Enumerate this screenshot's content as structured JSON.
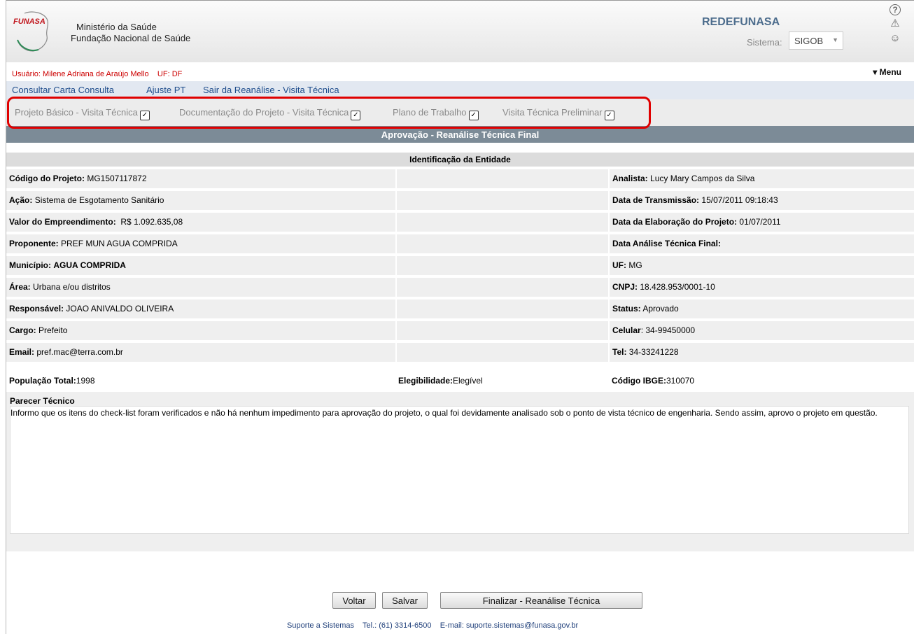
{
  "header": {
    "logo_text": "FUNASA",
    "org_line1": "Ministério da Saúde",
    "org_line2": "Fundação Nacional de Saúde",
    "brand": "REDEFUNASA",
    "system_label": "Sistema:",
    "system_value": "SIGOB",
    "icons": [
      "help-icon",
      "warning-icon",
      "user-icon"
    ]
  },
  "user": {
    "label": "Usuário:",
    "name": "Milene Adriana de Araújo Mello",
    "uf_label": "UF:",
    "uf": "DF",
    "menu_label": "Menu"
  },
  "nav": {
    "items": [
      "Consultar Carta Consulta",
      "Ajuste PT",
      "Sair da Reanálise - Visita Técnica"
    ]
  },
  "tabs": {
    "items": [
      "Projeto Básico - Visita Técnica",
      "Documentação do Projeto - Visita Técnica",
      "Plano de Trabalho",
      "Visita Técnica Preliminar"
    ],
    "check": "✓"
  },
  "section": {
    "title": "Aprovação - Reanálise Técnica Final",
    "subtitle": "Identificação da Entidade"
  },
  "fields": {
    "codigo_label": "Código do Projeto:",
    "codigo": "MG1507117872",
    "analista_label": "Analista:",
    "analista": "Lucy Mary Campos da Silva",
    "acao_label": "Ação:",
    "acao": "Sistema de Esgotamento Sanitário",
    "transmissao_label": "Data de Transmissão:",
    "transmissao": "15/07/2011 09:18:43",
    "valor_label": "Valor do Empreendimento:",
    "valor": "R$ 1.092.635,08",
    "elaboracao_label": "Data da Elaboração do Projeto:",
    "elaboracao": "01/07/2011",
    "proponente_label": "Proponente:",
    "proponente": "PREF MUN AGUA COMPRIDA",
    "analise_label": "Data Análise Técnica Final:",
    "analise": "",
    "municipio_label": "Município:",
    "municipio": "AGUA COMPRIDA",
    "uf_label": "UF:",
    "uf": "MG",
    "area_label": "Área:",
    "area": "Urbana e/ou distritos",
    "cnpj_label": "CNPJ:",
    "cnpj": "18.428.953/0001-10",
    "responsavel_label": "Responsável:",
    "responsavel": "JOAO ANIVALDO OLIVEIRA",
    "status_label": "Status:",
    "status": "Aprovado",
    "cargo_label": "Cargo:",
    "cargo": "Prefeito",
    "celular_label": "Celular",
    "celular": ": 34-99450000",
    "email_label": "Email:",
    "email": "pref.mac@terra.com.br",
    "tel_label": "Tel:",
    "tel": "34-33241228",
    "populacao_label": "População Total:",
    "populacao": "1998",
    "elegibilidade_label": "Elegibilidade:",
    "elegibilidade": "Elegível",
    "ibge_label": "Código IBGE:",
    "ibge": "310070"
  },
  "parecer": {
    "label": "Parecer Técnico",
    "text": "Informo que os itens do check-list foram verificados e não há nenhum impedimento para aprovação do projeto, o qual foi devidamente analisado sob o ponto de vista técnico de engenharia. Sendo assim, aprovo o projeto em questão."
  },
  "buttons": {
    "voltar": "Voltar",
    "salvar": "Salvar",
    "finalizar": "Finalizar - Reanálise Técnica"
  },
  "footer": {
    "text": "Suporte a Sistemas    Tel.: (61) 3314-6500    E-mail: suporte.sistemas@funasa.gov.br"
  }
}
